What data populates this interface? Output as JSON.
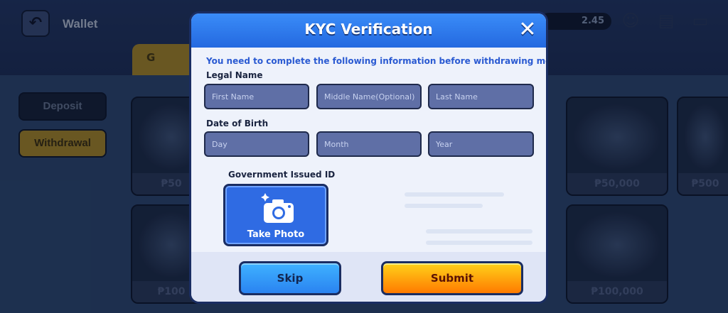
{
  "background": {
    "title": "Wallet",
    "balance": "2.45",
    "tab_label": "G",
    "side_buttons": {
      "deposit": "Deposit",
      "withdrawal": "Withdrawal"
    },
    "card_prices": [
      "₱50",
      "₱50,000",
      "₱500",
      "₱100",
      "₱100,000"
    ]
  },
  "modal": {
    "title": "KYC Verification",
    "close_glyph": "✕",
    "notice": "You need to complete the following information before withdrawing money.",
    "legal_name": {
      "label": "Legal Name",
      "first_placeholder": "First Name",
      "middle_placeholder": "Middle Name(Optional)",
      "last_placeholder": "Last Name"
    },
    "dob": {
      "label": "Date of Birth",
      "day_placeholder": "Day",
      "month_placeholder": "Month",
      "year_placeholder": "Year"
    },
    "gov_id": {
      "label": "Government Issued ID",
      "take_photo": "Take Photo",
      "icon": "camera-icon"
    },
    "buttons": {
      "skip": "Skip",
      "submit": "Submit"
    }
  },
  "colors": {
    "header_blue": "#2b74ea",
    "notice_blue": "#2a5ad2",
    "field_bg": "#5f6fa6",
    "submit_orange": "#ff9a00",
    "skip_blue": "#35a0ff"
  }
}
